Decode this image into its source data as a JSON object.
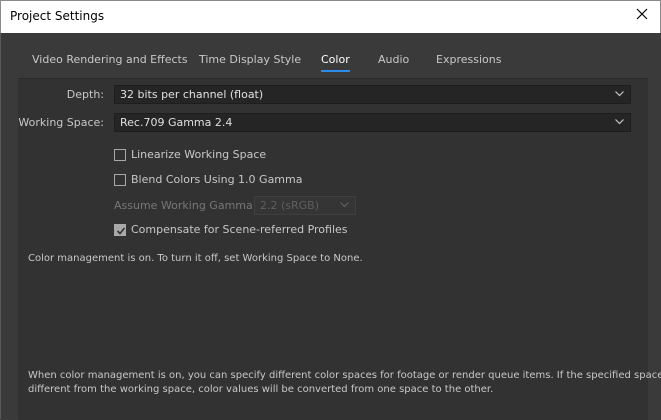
{
  "window": {
    "title": "Project Settings"
  },
  "tabs": [
    {
      "label": "Video Rendering and Effects",
      "active": false
    },
    {
      "label": "Time Display Style",
      "active": false
    },
    {
      "label": "Color",
      "active": true
    },
    {
      "label": "Audio",
      "active": false
    },
    {
      "label": "Expressions",
      "active": false
    }
  ],
  "color": {
    "depth_label": "Depth:",
    "depth_value": "32 bits per channel (float)",
    "working_space_label": "Working Space:",
    "working_space_value": "Rec.709 Gamma 2.4",
    "linearize_label": "Linearize Working Space",
    "linearize_checked": false,
    "blend_label": "Blend Colors Using 1.0 Gamma",
    "blend_checked": false,
    "assume_gamma_label": "Assume Working Gamma:",
    "assume_gamma_value": "2.2 (sRGB)",
    "assume_gamma_enabled": false,
    "compensate_label": "Compensate for Scene-referred Profiles",
    "compensate_checked": true,
    "status_note": "Color management is on. To turn it off, set Working Space to None.",
    "footer_note_line1": "When color management is on, you can specify different color spaces for footage or render queue items. If the specified space is",
    "footer_note_line2": "different from the working space, color values will be converted from one space to the other."
  },
  "colors": {
    "accent": "#2d8ceb",
    "panel": "#323232",
    "field": "#252525"
  }
}
